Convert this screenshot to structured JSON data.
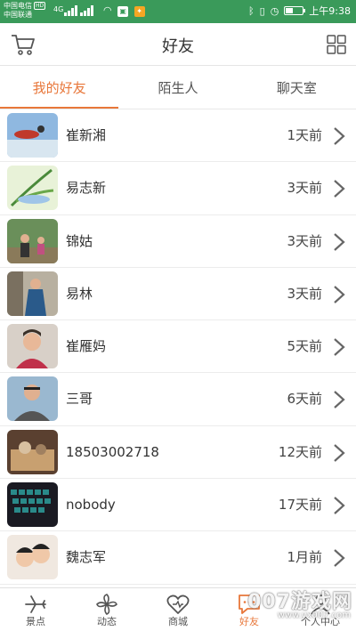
{
  "status_bar": {
    "carrier1": "中国电信",
    "hd": "HD",
    "carrier2": "中国联通",
    "network": "4G",
    "time": "上午9:38",
    "battery_level": 0.45
  },
  "header": {
    "title": "好友"
  },
  "tabs": [
    {
      "label": "我的好友",
      "active": true
    },
    {
      "label": "陌生人",
      "active": false
    },
    {
      "label": "聊天室",
      "active": false
    }
  ],
  "friends": [
    {
      "name": "崔新湘",
      "time": "1天前"
    },
    {
      "name": "易志新",
      "time": "3天前"
    },
    {
      "name": "锦姑",
      "time": "3天前"
    },
    {
      "name": "易林",
      "time": "3天前"
    },
    {
      "name": "崔雁妈",
      "time": "5天前"
    },
    {
      "name": "三哥",
      "time": "6天前"
    },
    {
      "name": "18503002718",
      "time": "12天前"
    },
    {
      "name": "nobody",
      "time": "17天前"
    },
    {
      "name": "魏志军",
      "time": "1月前"
    }
  ],
  "bottom_nav": [
    {
      "label": "景点",
      "icon": "airplane-icon"
    },
    {
      "label": "动态",
      "icon": "pinwheel-icon"
    },
    {
      "label": "商城",
      "icon": "heart-icon"
    },
    {
      "label": "好友",
      "icon": "chat-bubble-icon",
      "active": true
    },
    {
      "label": "个人中心",
      "icon": "person-icon"
    }
  ],
  "watermark": {
    "main": "007游戏网",
    "sub": "www.yx007.com"
  },
  "colors": {
    "accent": "#e8773a",
    "status_bar": "#3a9a5a"
  }
}
